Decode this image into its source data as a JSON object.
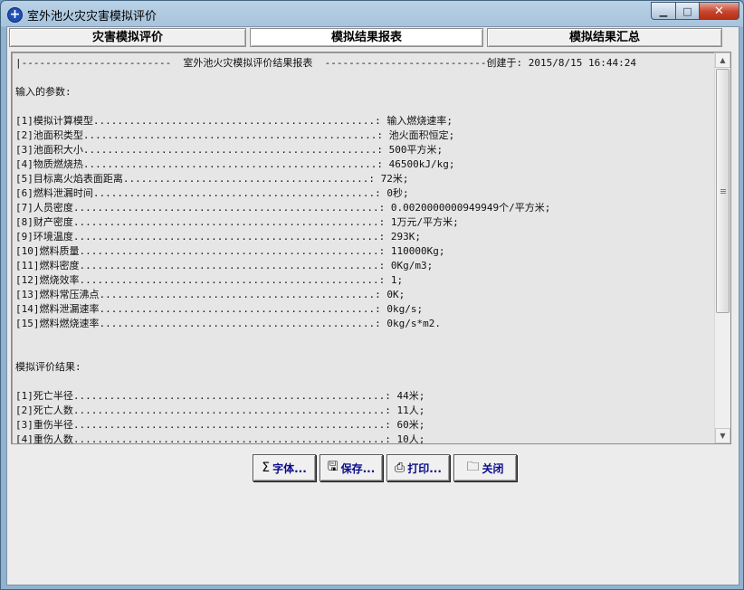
{
  "window": {
    "title": "室外池火灾灾害模拟评价",
    "min_label": "▁",
    "max_label": "□",
    "close_label": "✕"
  },
  "tabs": [
    {
      "label": "灾害模拟评价"
    },
    {
      "label": "模拟结果报表"
    },
    {
      "label": "模拟结果汇总"
    }
  ],
  "report": {
    "lines": [
      "|-------------------------  室外池火灾模拟评价结果报表  ---------------------------创建于: 2015/8/15 16:44:24",
      "",
      "输入的参数:",
      "",
      "[1]模拟计算模型...............................................: 输入燃烧速率;",
      "[2]池面积类型.................................................: 池火面积恒定;",
      "[3]池面积大小.................................................: 500平方米;",
      "[4]物质燃烧热.................................................: 46500kJ/kg;",
      "[5]目标离火焰表面距离.........................................: 72米;",
      "[6]燃料泄漏时间...............................................: 0秒;",
      "[7]人员密度...................................................: 0.0020000000949949个/平方米;",
      "[8]财产密度...................................................: 1万元/平方米;",
      "[9]环境温度...................................................: 293K;",
      "[10]燃料质量..................................................: 110000Kg;",
      "[11]燃料密度..................................................: 0Kg/m3;",
      "[12]燃烧效率..................................................: 1;",
      "[13]燃料常压沸点..............................................: 0K;",
      "[14]燃料泄漏速率..............................................: 0kg/s;",
      "[15]燃料燃烧速率..............................................: 0kg/s*m2.",
      "",
      "",
      "模拟评价结果:",
      "",
      "[1]死亡半径....................................................: 44米;",
      "[2]死亡人数....................................................: 11人;",
      "[3]重伤半径....................................................: 60米;",
      "[4]重伤人数....................................................: 10人;"
    ]
  },
  "buttons": {
    "font": {
      "icon": "sigma-icon",
      "glyph": "Σ",
      "label": "字体..."
    },
    "save": {
      "icon": "floppy-disk-icon",
      "glyph": "🖫",
      "label": "保存..."
    },
    "print": {
      "icon": "printer-icon",
      "glyph": "⎙",
      "label": "打印..."
    },
    "close": {
      "icon": "folder-icon",
      "glyph": "🗀",
      "label": "关闭"
    }
  }
}
